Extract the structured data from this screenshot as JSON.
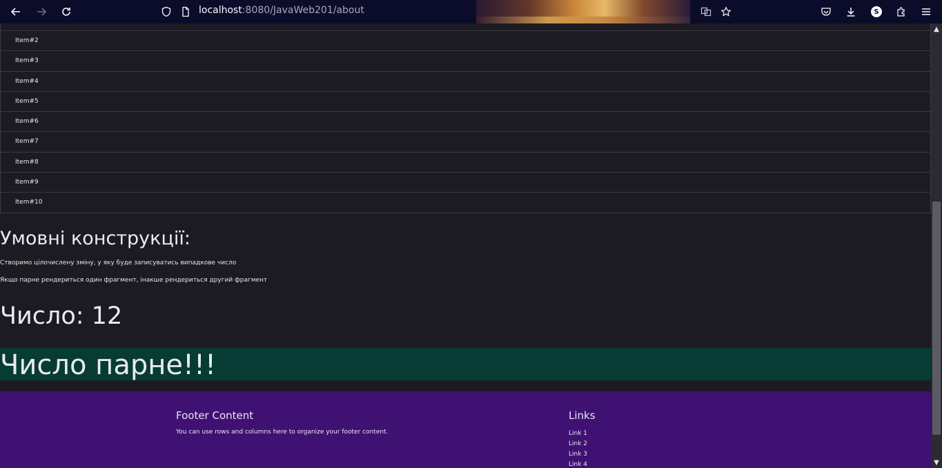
{
  "browser": {
    "url_host": "localhost",
    "url_rest": ":8080/JavaWeb201/about",
    "avatar_letter": "S"
  },
  "list": {
    "items": [
      "Item#2",
      "Item#3",
      "Item#4",
      "Item#5",
      "Item#6",
      "Item#7",
      "Item#8",
      "Item#9",
      "Item#10"
    ]
  },
  "conditions": {
    "heading": "Умовні конструкції:",
    "p1": "Створимо цілочислену зміну, у яку буде записуватись випадкове число",
    "p2": "Якщо парне рендериться один фрагмент, інакше рендериться другий фрагмент",
    "number_text": "Число: 12",
    "even_text": "Число парне!!!"
  },
  "footer": {
    "content_title": "Footer Content",
    "content_text": "You can use rows and columns here to organize your footer content.",
    "links_title": "Links",
    "links": [
      "Link 1",
      "Link 2",
      "Link 3",
      "Link 4"
    ]
  },
  "colors": {
    "page_bg": "#1c1b22",
    "even_bar": "#063c34",
    "footer_bg": "#3f1172",
    "toolbar_bg": "#0b0c2a"
  }
}
